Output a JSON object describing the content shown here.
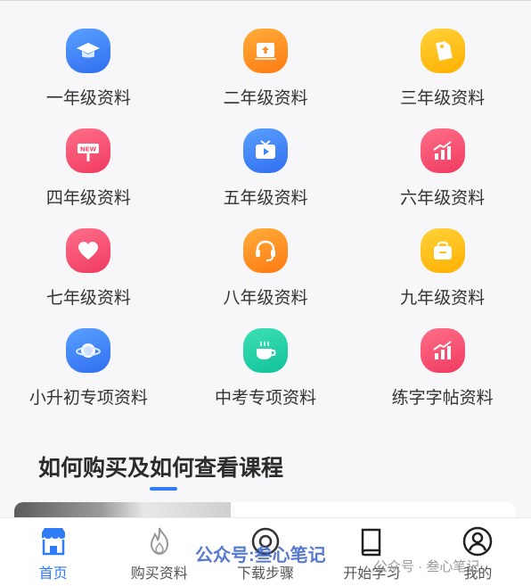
{
  "grades": [
    {
      "label": "一年级资料",
      "icon": "graduation-cap-icon",
      "color": "#3d86f7"
    },
    {
      "label": "二年级资料",
      "icon": "upload-board-icon",
      "color": "#ff8a1f"
    },
    {
      "label": "三年级资料",
      "icon": "price-tag-icon",
      "color": "#ffbe1a"
    },
    {
      "label": "四年级资料",
      "icon": "new-signpost-icon",
      "color": "#f24a6a"
    },
    {
      "label": "五年级资料",
      "icon": "tv-play-icon",
      "color": "#3d86f7"
    },
    {
      "label": "六年级资料",
      "icon": "rising-chart-icon",
      "color": "#f24a6a"
    },
    {
      "label": "七年级资料",
      "icon": "heart-icon",
      "color": "#f24a6a"
    },
    {
      "label": "八年级资料",
      "icon": "headset-icon",
      "color": "#ff8a1f"
    },
    {
      "label": "九年级资料",
      "icon": "shopping-bag-icon",
      "color": "#ffbe1a"
    },
    {
      "label": "小升初专项资料",
      "icon": "planet-icon",
      "color": "#3d86f7"
    },
    {
      "label": "中考专项资料",
      "icon": "coffee-cup-icon",
      "color": "#15c89f"
    },
    {
      "label": "练字字帖资料",
      "icon": "rising-chart-icon",
      "color": "#f24a6a"
    }
  ],
  "section": {
    "title": "如何购买及如何查看课程"
  },
  "tabbar": {
    "items": [
      {
        "label": "首页",
        "icon": "store-home-icon",
        "active": true
      },
      {
        "label": "购买资料",
        "icon": "flame-icon",
        "active": false
      },
      {
        "label": "下载步骤",
        "icon": "download-circle-icon",
        "active": false
      },
      {
        "label": "开始学习",
        "icon": "book-icon",
        "active": false
      },
      {
        "label": "我的",
        "icon": "user-circle-icon",
        "active": false
      }
    ]
  },
  "watermark": {
    "main": "公众号:叁心笔记",
    "small": "公众号 · 叁心笔记"
  },
  "colors": {
    "accent": "#2f7cf6"
  }
}
